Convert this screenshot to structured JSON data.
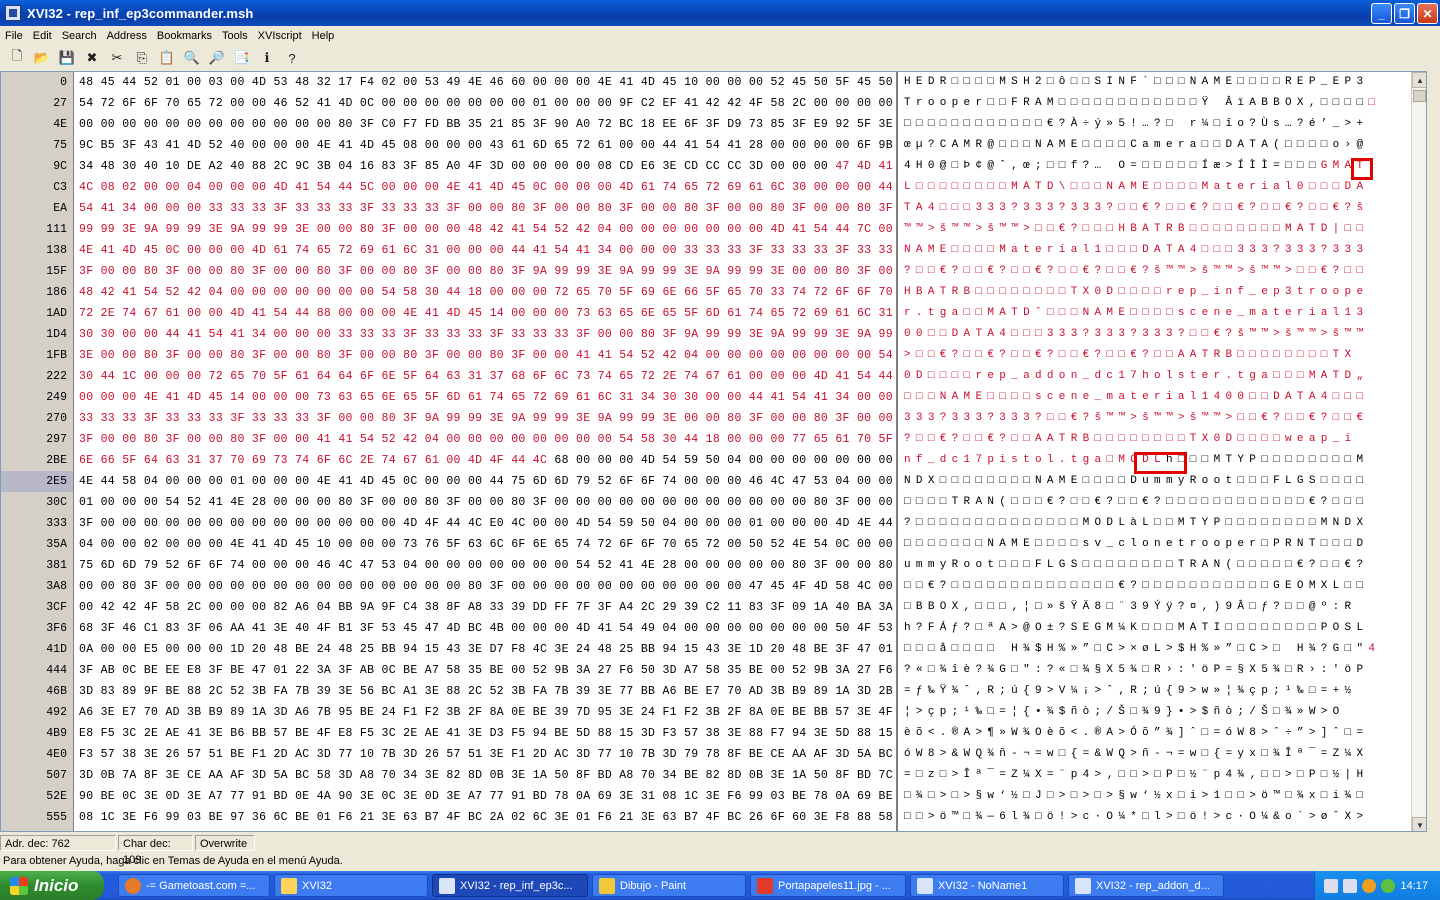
{
  "window": {
    "title": "XVI32 - rep_inf_ep3commander.msh",
    "minimize": "_",
    "maximize": "❐",
    "close": "✕"
  },
  "menu": [
    "File",
    "Edit",
    "Search",
    "Address",
    "Bookmarks",
    "Tools",
    "XVIscript",
    "Help"
  ],
  "toolbar": {
    "icons": [
      "new-file-icon",
      "open-folder-icon",
      "save-icon",
      "close-x-icon",
      "cut-icon",
      "copy-icon",
      "paste-icon",
      "find-icon",
      "replace-icon",
      "bookmark-icon",
      "info-icon",
      "help-icon"
    ],
    "glyphs": [
      "🗋",
      "📂",
      "💾",
      "✖",
      "✂",
      "⎘",
      "📋",
      "🔍",
      "🔎",
      "📑",
      "ℹ",
      "?"
    ]
  },
  "hex_rows": [
    {
      "addr": "0",
      "hex": "48 45 44 52 01 00 03 00 4D 53 48 32 17 F4 02 00 53 49 4E 46 60 00 00 00 4E 41 4D 45 10 00 00 00 52 45 50 5F 45 50 33",
      "text": "HEDR□□□□MSH2□ô□□SINF`□□□NAME□□□□REP_EP3",
      "red_from": 39
    },
    {
      "addr": "27",
      "hex": "54 72 6F 6F 70 65 72 00 00 46 52 41 4D 0C 00 00 00 00 00 00 00 01 00 00 00 9F C2 EF 41 42 42 4F 58 2C 00 00 00 00 00",
      "text": "Trooper□□FRAM□□□□□□□□□□□□Ÿ ÂïABBOX,□□□□□",
      "red_from": 39
    },
    {
      "addr": "4E",
      "hex": "00 00 00 00 00 00 00 00 00 00 00 00 80 3F C0 F7 FD BB 35 21 85 3F 90 A0 72 BC 18 EE 6F 3F D9 73 85 3F E9 92 5F 3E 2B",
      "text": "□□□□□□□□□□□□€?À÷ý»5!…?□ r¼□îo?Ùs…?é’_>+",
      "red_from": 39
    },
    {
      "addr": "75",
      "hex": "9C B5 3F 43 41 4D 52 40 00 00 00 4E 41 4D 45 08 00 00 00 43 61 6D 65 72 61 00 00 44 41 54 41 28 00 00 00 00 6F 9B 40",
      "text": "œµ?CAMR@□□□NAME□□□□Camera□□DATA(□□□□o›@",
      "red_from": 39
    },
    {
      "addr": "9C",
      "hex": "34 48 30 40 10 DE A2 40 88 2C 9C 3B 04 16 83 3F 85 A0 4F 3D 00 00 00 00 08 CD E6 3E CD CC CC 3D 00 00 00 47 4D 41 54",
      "text": "4H0@□Þ¢@ˆ,œ;□□f?… O=□□□□□Íæ>ÍÌÌ=□□□GMAT",
      "red_from": 35
    },
    {
      "addr": "C3",
      "hex": "4C 08 02 00 00 04 00 00 00 4D 41 54 44 5C 00 00 00 4E 41 4D 45 0C 00 00 00 4D 61 74 65 72 69 61 6C 30 00 00 00 44 41",
      "text": "L□□□□□□□□MATD\\□□□NAME□□□□Material0□□□DA",
      "red_from": 0
    },
    {
      "addr": "EA",
      "hex": "54 41 34 00 00 00 33 33 33 3F 33 33 33 3F 33 33 33 3F 00 00 80 3F 00 00 80 3F 00 00 80 3F 00 00 80 3F 00 00 80 3F 9A",
      "text": "TA4□□□333?333?333?□□€?□□€?□□€?□□€?□□€?š",
      "red_from": 0
    },
    {
      "addr": "111",
      "hex": "99 99 3E 9A 99 99 3E 9A 99 99 3E 00 00 80 3F 00 00 00 48 42 41 54 52 42 04 00 00 00 00 00 00 00 4D 41 54 44 7C 00 00",
      "text": "™™>š™™>š™™>□□€?□□□HBATRB□□□□□□□□MATD|□□",
      "red_from": 0
    },
    {
      "addr": "138",
      "hex": "4E 41 4D 45 0C 00 00 00 4D 61 74 65 72 69 61 6C 31 00 00 00 44 41 54 41 34 00 00 00 33 33 33 3F 33 33 33 3F 33 33 33",
      "text": "NAME□□□□Material1□□□DATA4□□□333?333?333",
      "red_from": 0
    },
    {
      "addr": "15F",
      "hex": "3F 00 00 80 3F 00 00 80 3F 00 00 80 3F 00 00 80 3F 00 00 80 3F 9A 99 99 3E 9A 99 99 3E 9A 99 99 3E 00 00 80 3F 00 00",
      "text": "?□□€?□□€?□□€?□□€?□□€?š™™>š™™>š™™>□□€?□□",
      "red_from": 0
    },
    {
      "addr": "186",
      "hex": "48 42 41 54 52 42 04 00 00 00 00 00 00 00 54 58 30 44 18 00 00 00 72 65 70 5F 69 6E 66 5F 65 70 33 74 72 6F 6F 70 65",
      "text": "HBATRB□□□□□□□□TX0D□□□□rep_inf_ep3troope",
      "red_from": 0
    },
    {
      "addr": "1AD",
      "hex": "72 2E 74 67 61 00 00 4D 41 54 44 88 00 00 00 4E 41 4D 45 14 00 00 00 73 63 65 6E 65 5F 6D 61 74 65 72 69 61 6C 31 33",
      "text": "r.tga□□MATDˆ□□□NAME□□□□scene_material13",
      "red_from": 0
    },
    {
      "addr": "1D4",
      "hex": "30 30 00 00 44 41 54 41 34 00 00 00 33 33 33 3F 33 33 33 3F 33 33 33 3F 00 00 80 3F 9A 99 99 3E 9A 99 99 3E 9A 99 99",
      "text": "00□□DATA4□□□333?333?333?□□€?š™™>š™™>š™™",
      "red_from": 0
    },
    {
      "addr": "1FB",
      "hex": "3E 00 00 80 3F 00 00 80 3F 00 00 80 3F 00 00 80 3F 00 00 80 3F 00 00 41 41 54 52 42 04 00 00 00 00 00 00 00 00 54 58",
      "text": ">□□€?□□€?□□€?□□€?□□€?□□AATRB□□□□□□□□TX",
      "red_from": 0
    },
    {
      "addr": "222",
      "hex": "30 44 1C 00 00 00 72 65 70 5F 61 64 64 6F 6E 5F 64 63 31 37 68 6F 6C 73 74 65 72 2E 74 67 61 00 00 00 4D 41 54 44 84",
      "text": "0D□□□□rep_addon_dc17holster.tga□□□MATD„",
      "red_from": 0
    },
    {
      "addr": "249",
      "hex": "00 00 00 4E 41 4D 45 14 00 00 00 73 63 65 6E 65 5F 6D 61 74 65 72 69 61 6C 31 34 30 30 00 00 44 41 54 41 34 00 00 00",
      "text": "□□□NAME□□□□scene_material1400□□DATA4□□□",
      "red_from": 0
    },
    {
      "addr": "270",
      "hex": "33 33 33 3F 33 33 33 3F 33 33 33 3F 00 00 80 3F 9A 99 99 3E 9A 99 99 3E 9A 99 99 3E 00 00 80 3F 00 00 80 3F 00 00 80",
      "text": "333?333?333?□□€?š™™>š™™>š™™>□□€?□□€?□□€",
      "red_from": 0
    },
    {
      "addr": "297",
      "hex": "3F 00 00 80 3F 00 00 80 3F 00 00 41 41 54 52 42 04 00 00 00 00 00 00 00 00 54 58 30 44 18 00 00 00 77 65 61 70 5F 69",
      "text": "?□□€?□□€?□□AATRB□□□□□□□□TX0D□□□□weap_i",
      "red_from": 0
    },
    {
      "addr": "2BE",
      "hex": "6E 66 5F 64 63 31 37 70 69 73 74 6F 6C 2E 74 67 61 00 4D 4F 44 4C 68 00 00 00 4D 54 59 50 04 00 00 00 00 00 00 00 4D",
      "text": "nf_dc17pistol.tga□MODLh□□□MTYP□□□□□□□□M",
      "red_from": 0,
      "black_from": 22
    },
    {
      "addr": "2E5",
      "hex": "4E 44 58 04 00 00 00 01 00 00 00 4E 41 4D 45 0C 00 00 00 44 75 6D 6D 79 52 6F 6F 74 00 00 00 46 4C 47 53 04 00 00 00",
      "text": "NDX□□□□□□□□NAME□□□□DummyRoot□□□FLGS□□□□",
      "red_from": 39,
      "current": true
    },
    {
      "addr": "30C",
      "hex": "01 00 00 00 54 52 41 4E 28 00 00 00 80 3F 00 00 80 3F 00 00 80 3F 00 00 00 00 00 00 00 00 00 00 00 00 80 3F 00 00 00",
      "text": "□□□□TRAN(□□□€?□□€?□□€?□□□□□□□□□□□□€?□□□",
      "red_from": 39
    },
    {
      "addr": "333",
      "hex": "3F 00 00 00 00 00 00 00 00 00 00 00 00 00 00 4D 4F 44 4C E0 4C 00 00 4D 54 59 50 04 00 00 00 01 00 00 00 4D 4E 44 58",
      "text": "?□□□□□□□□□□□□□□MODLàL□□MTYP□□□□□□□□MNDX",
      "red_from": 39
    },
    {
      "addr": "35A",
      "hex": "04 00 00 02 00 00 00 4E 41 4D 45 10 00 00 00 73 76 5F 63 6C 6F 6E 65 74 72 6F 6F 70 65 72 00 50 52 4E 54 0C 00 00 44",
      "text": "□□□□□□□NAME□□□□sv_clonetrooper□PRNT□□□D",
      "red_from": 39
    },
    {
      "addr": "381",
      "hex": "75 6D 6D 79 52 6F 6F 74 00 00 00 46 4C 47 53 04 00 00 00 00 00 00 00 54 52 41 4E 28 00 00 00 00 00 80 3F 00 00 80 3F",
      "text": "ummyRoot□□□FLGS□□□□□□□□TRAN(□□□□□€?□□€?",
      "red_from": 39
    },
    {
      "addr": "3A8",
      "hex": "00 00 80 3F 00 00 00 00 00 00 00 00 00 00 00 00 00 00 80 3F 00 00 00 00 00 00 00 00 00 00 00 47 45 4F 4D 58 4C 00 00",
      "text": "□□€?□□□□□□□□□□□□□□€?□□□□□□□□□□□GEOMXL□□",
      "red_from": 39
    },
    {
      "addr": "3CF",
      "hex": "00 42 42 4F 58 2C 00 00 00 82 A6 04 BB 9A 9F C4 38 8F A8 33 39 DD FF 7F 3F A4 2C 29 39 C2 11 83 3F 09 1A 40 BA 3A 52",
      "text": "□BBOX,□□□‚¦□»šŸÄ8□¨39Ýÿ?¤,)9Â□ƒ?□□@º:R",
      "red_from": 39
    },
    {
      "addr": "3F6",
      "hex": "68 3F 46 C1 83 3F 06 AA 41 3E 40 4F B1 3F 53 45 47 4D BC 4B 00 00 00 4D 41 54 49 04 00 00 00 00 00 00 00 50 4F 53 4C",
      "text": "h?FÁƒ?□ªA>@O±?SEGM¼K□□□MATI□□□□□□□□POSL",
      "red_from": 39
    },
    {
      "addr": "41D",
      "hex": "0A 00 00 E5 00 00 00 1D 20 48 BE 24 48 25 BB 94 15 43 3E D7 F8 4C 3E 24 48 25 BB 94 15 43 3E 1D 20 48 BE 3F 47 01 22 34",
      "text": "□□□å□□□□ H¾$H%»”□C>×øL>$H%»”□C>□ H¾?G□\"4",
      "red_from": 39
    },
    {
      "addr": "444",
      "hex": "3F AB 0C BE EE E8 3F BE 47 01 22 3A 3F AB 0C BE A7 58 35 BE 00 52 9B 3A 27 F6 50 3D A7 58 35 BE 00 52 9B 3A 27 F6 50",
      "text": "?«□¾îè?¾G□\":?«□¾§X5¾□R›:'öP=§X5¾□R›:'öP",
      "red_from": 39
    },
    {
      "addr": "46B",
      "hex": "3D 83 89 9F BE 88 2C 52 3B FA 7B 39 3E 56 BC A1 3E 88 2C 52 3B FA 7B 39 3E 77 BB A6 BE E7 70 AD 3B B9 89 1A 3D 2B BD",
      "text": "=ƒ‰Ÿ¾ˆ,R;ú{9>V¼¡>ˆ,R;ú{9>w»¦¾çp­;¹‰□=+½",
      "red_from": 39
    },
    {
      "addr": "492",
      "hex": "A6 3E E7 70 AD 3B B9 89 1A 3D A6 7B 95 BE 24 F1 F2 3B 2F 8A 0E BE 39 7D 95 3E 24 F1 F2 3B 2F 8A 0E BE BB 57 3E 4F",
      "text": "¦>çp­;¹‰□=¦{•¾$ñò;/Š□¾9}•>$ñò;/Š□¾»W>O",
      "red_from": 39
    },
    {
      "addr": "4B9",
      "hex": "E8 F5 3C 2E AE 41 3E B6 BB 57 BE 4F E8 F5 3C 2E AE 41 3E D3 F5 94 BE 5D 88 15 3D F3 57 38 3E 88 F7 94 3E 5D 88 15 3D",
      "text": "èõ<.®A>¶»W¾Oèõ<.®A>Óõ”¾]ˆ□=óW8>ˆ÷”>]ˆ□=",
      "red_from": 39
    },
    {
      "addr": "4E0",
      "hex": "F3 57 38 3E 26 57 51 BE F1 2D AC 3D 77 10 7B 3D 26 57 51 3E F1 2D AC 3D 77 10 7B 3D 79 78 8F BE CE AA AF 3D 5A BC 58",
      "text": "óW8>&WQ¾ñ-¬=w□{=&WQ>ñ-¬=w□{=yx□¾Îª¯=Z¼X",
      "red_from": 39
    },
    {
      "addr": "507",
      "hex": "3D 0B 7A 8F 3E CE AA AF 3D 5A BC 58 3D A8 70 34 3E 82 8D 0B 3E 1A 50 8F BD A8 70 34 BE 82 8D 0B 3E 1A 50 8F BD 7C 48",
      "text": "=□z□>Îª¯=Z¼X=¨p4>‚□□>□P□½¨p4¾‚□□>□P□½|H",
      "red_from": 39
    },
    {
      "addr": "52E",
      "hex": "90 BE 0C 3E 0D 3E A7 77 91 BD 0E 4A 90 3E 0C 3E 0D 3E A7 77 91 BD 78 0A 69 3E 31 08 1C 3E F6 99 03 BE 78 0A 69 BE 81",
      "text": "□¾□>□>§w‘½□J□>□>□>§w‘½x□i>1□□>ö™□¾x□i¾□",
      "red_from": 39
    },
    {
      "addr": "555",
      "hex": "08 1C 3E F6 99 03 BE 97 36 6C BE 01 F6 21 3E 63 B7 4F BC 2A 02 6C 3E 01 F6 21 3E 63 B7 4F BC 26 6F 60 3E F8 88 58 3E",
      "text": "□□>ö™□¾—6l¾□ö!>c·O¼*□l>□ö!>c·O¼&o`>øˆX>",
      "red_from": 39
    }
  ],
  "status": {
    "addr": "Adr. dec: 762",
    "char": "Char dec: 109",
    "mode": "Overwrite",
    "help": "Para obtener Ayuda, haga clic en Temas de Ayuda en el menú Ayuda."
  },
  "taskbar": {
    "start": "Inicio",
    "tasks": [
      {
        "label": "-= Gametoast.com =...",
        "active": false
      },
      {
        "label": "XVI32",
        "active": false
      },
      {
        "label": "XVI32 - rep_inf_ep3c...",
        "active": true
      },
      {
        "label": "Dibujo - Paint",
        "active": false
      },
      {
        "label": "Portapapeles11.jpg - ...",
        "active": false
      },
      {
        "label": "XVI32 - NoName1",
        "active": false
      },
      {
        "label": "XVI32 - rep_addon_d...",
        "active": false
      }
    ],
    "clock": "14:17"
  },
  "colors": {
    "red_text": "#c8102e",
    "highlight_box": "#e00000"
  }
}
